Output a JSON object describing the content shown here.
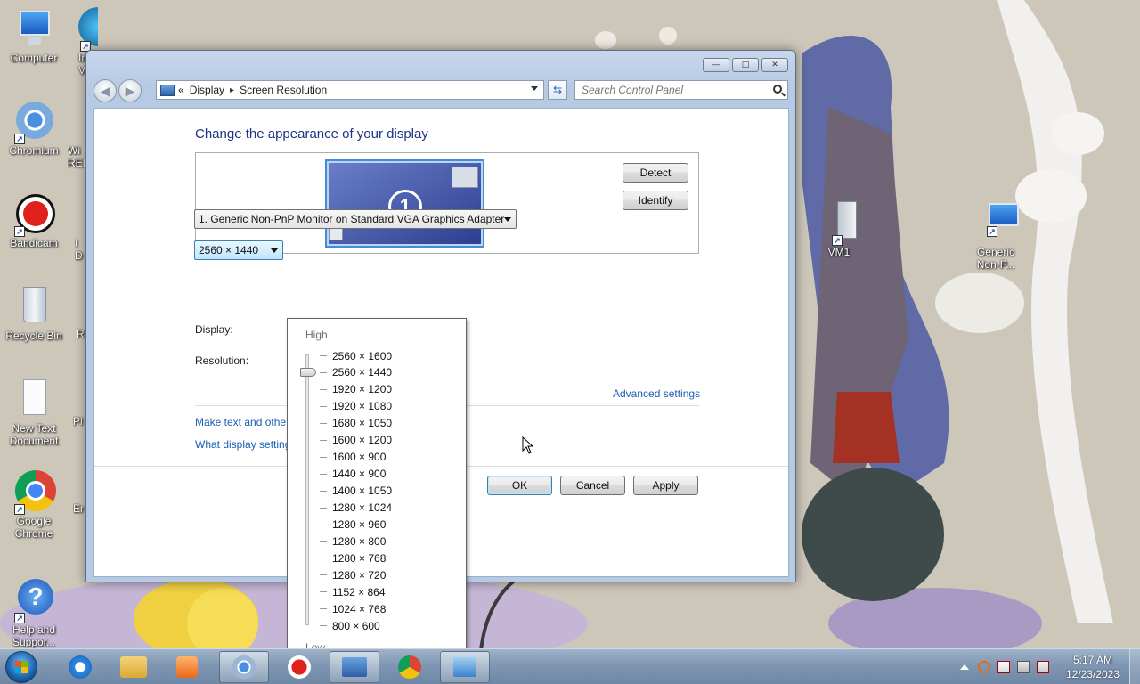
{
  "desktop": {
    "icons": [
      {
        "label": "Computer"
      },
      {
        "label": "Im",
        "label2": "Ve"
      },
      {
        "label": "Chromium"
      },
      {
        "label": "Wi",
        "label2": "REI"
      },
      {
        "label": "Bandicam"
      },
      {
        "label": "I",
        "label2": "D"
      },
      {
        "label": "Recycle Bin"
      },
      {
        "label": "R"
      },
      {
        "label": "New Text",
        "label2": "Document"
      },
      {
        "label": "Pl"
      },
      {
        "label": "Google",
        "label2": "Chrome"
      },
      {
        "label": "Er"
      },
      {
        "label": "Help and",
        "label2": "Suppor..."
      },
      {
        "label": "VM1"
      },
      {
        "label": "Generic",
        "label2": "Non-P..."
      }
    ]
  },
  "window": {
    "breadcrumb": {
      "chevrons": "«",
      "items": [
        "Display",
        "Screen Resolution"
      ],
      "separator": "▸"
    },
    "search": {
      "placeholder": "Search Control Panel"
    },
    "caption": {
      "minimize": "—",
      "maximize": "□",
      "close": "✕"
    },
    "nav": {
      "back": "◀",
      "forward": "▶",
      "refresh": "⇆"
    }
  },
  "screen_resolution": {
    "title": "Change the appearance of your display",
    "monitor_number": "1",
    "detect_label": "Detect",
    "identify_label": "Identify",
    "display_label": "Display:",
    "display_value": "1. Generic Non-PnP Monitor on Standard VGA Graphics Adapter",
    "resolution_label": "Resolution:",
    "resolution_value": "2560 × 1440",
    "advanced_link": "Advanced settings",
    "link_text_size": "Make text and other",
    "link_display_settings": "What display setting",
    "ok_label": "OK",
    "cancel_label": "Cancel",
    "apply_label": "Apply"
  },
  "resolution_dropdown": {
    "high_label": "High",
    "low_label": "Low",
    "selected": "2560 × 1440",
    "options": [
      "2560 × 1600",
      "2560 × 1440",
      "1920 × 1200",
      "1920 × 1080",
      "1680 × 1050",
      "1600 × 1200",
      "1600 × 900",
      "1440 × 900",
      "1400 × 1050",
      "1280 × 1024",
      "1280 × 960",
      "1280 × 800",
      "1280 × 768",
      "1280 × 720",
      "1152 × 864",
      "1024 × 768",
      "800 × 600"
    ]
  },
  "taskbar": {
    "clock_time": "5:17 AM",
    "clock_date": "12/23/2023",
    "tray_icons": [
      "show-hidden-icons",
      "search-tool-icon",
      "flag-alert-icon",
      "network-icon",
      "volume-muted-icon"
    ],
    "pinned": [
      "internet-explorer-icon",
      "file-explorer-icon",
      "media-player-icon",
      "chromium-icon",
      "bandicam-icon",
      "remote-desktop-icon",
      "google-chrome-icon",
      "control-panel-icon"
    ]
  },
  "colors": {
    "title_blue": "#1e3287",
    "link_blue": "#1b5eb3",
    "taskbar": "#7f97b3"
  }
}
